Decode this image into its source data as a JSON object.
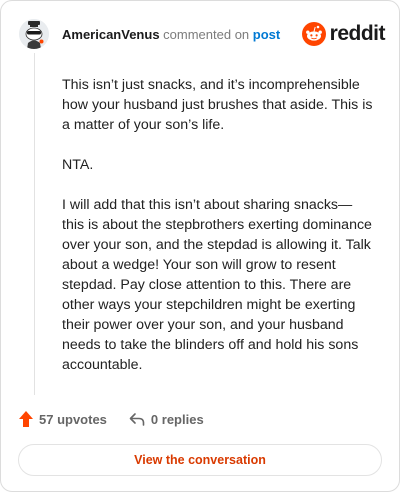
{
  "header": {
    "author": "AmericanVenus",
    "action_text": "commented on",
    "post_link": "post",
    "brand_name": "reddit",
    "brand_color": "#ff4500",
    "avatar_icon": "snoo-avatar-icon"
  },
  "comment": {
    "paragraphs": [
      "This isn’t just snacks, and it’s incomprehensible how your husband just brushes that aside. This is a matter of your son’s life.",
      "NTA.",
      "I will add that this isn’t about sharing snacks— this is about the stepbrothers exerting dominance over your son, and the stepdad is allowing it. Talk about a wedge! Your son will grow to resent stepdad. Pay close attention to this. There are other ways your stepchildren might be exerting their power over your son, and your husband needs to take the blinders off and hold his sons accountable."
    ]
  },
  "stats": {
    "upvotes_label": "57 upvotes",
    "replies_label": "0 replies",
    "upvote_icon": "upvote-arrow-icon",
    "reply_icon": "reply-icon"
  },
  "cta": {
    "label": "View the conversation",
    "color": "#d93a00"
  }
}
